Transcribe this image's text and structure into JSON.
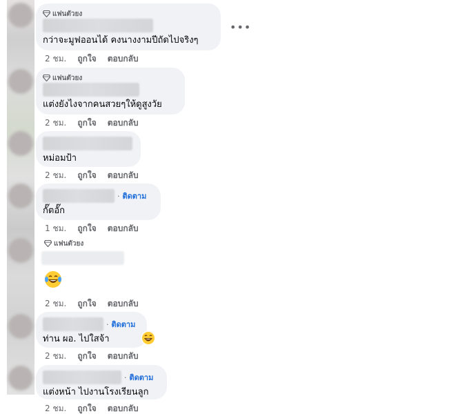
{
  "comments": [
    {
      "badge": "แฟนตัวยง",
      "text": "กว่าจะมูฟออนได้ คงนางงามปีถัดไปจริงๆ",
      "time": "2 ชม.",
      "like": "ถูกใจ",
      "reply": "ตอบกลับ"
    },
    {
      "badge": "แฟนตัวยง",
      "text": "แต่งยังไงจากคนสวยๆให้ดูสูงวัย",
      "time": "2 ชม.",
      "like": "ถูกใจ",
      "reply": "ตอบกลับ"
    },
    {
      "text": "หม่อมป้า",
      "time": "2 ชม.",
      "like": "ถูกใจ",
      "reply": "ตอบกลับ"
    },
    {
      "follow": "ติดตาม",
      "text": "กั๊ตอั๊ก",
      "time": "1 ชม.",
      "like": "ถูกใจ",
      "reply": "ตอบกลับ"
    },
    {
      "badge": "แฟนตัวยง",
      "emoji": "laughing-tears-emoji",
      "time": "2 ชม.",
      "like": "ถูกใจ",
      "reply": "ตอบกลับ"
    },
    {
      "follow": "ติดตาม",
      "text": "ท่าน ผอ. ไปใสจ้า",
      "reaction": "laughing-emoji",
      "time": "2 ชม.",
      "like": "ถูกใจ",
      "reply": "ตอบกลับ"
    },
    {
      "follow": "ติดตาม",
      "text": "แต่งหน้า ไปงานโรงเรียนลูก",
      "time": "2 ชม.",
      "like": "ถูกใจ",
      "reply": "ตอบกลับ"
    }
  ],
  "more_label": "•••",
  "colors": {
    "bubble": "#f0f2f5",
    "link": "#216fdb",
    "meta": "#65676b"
  }
}
